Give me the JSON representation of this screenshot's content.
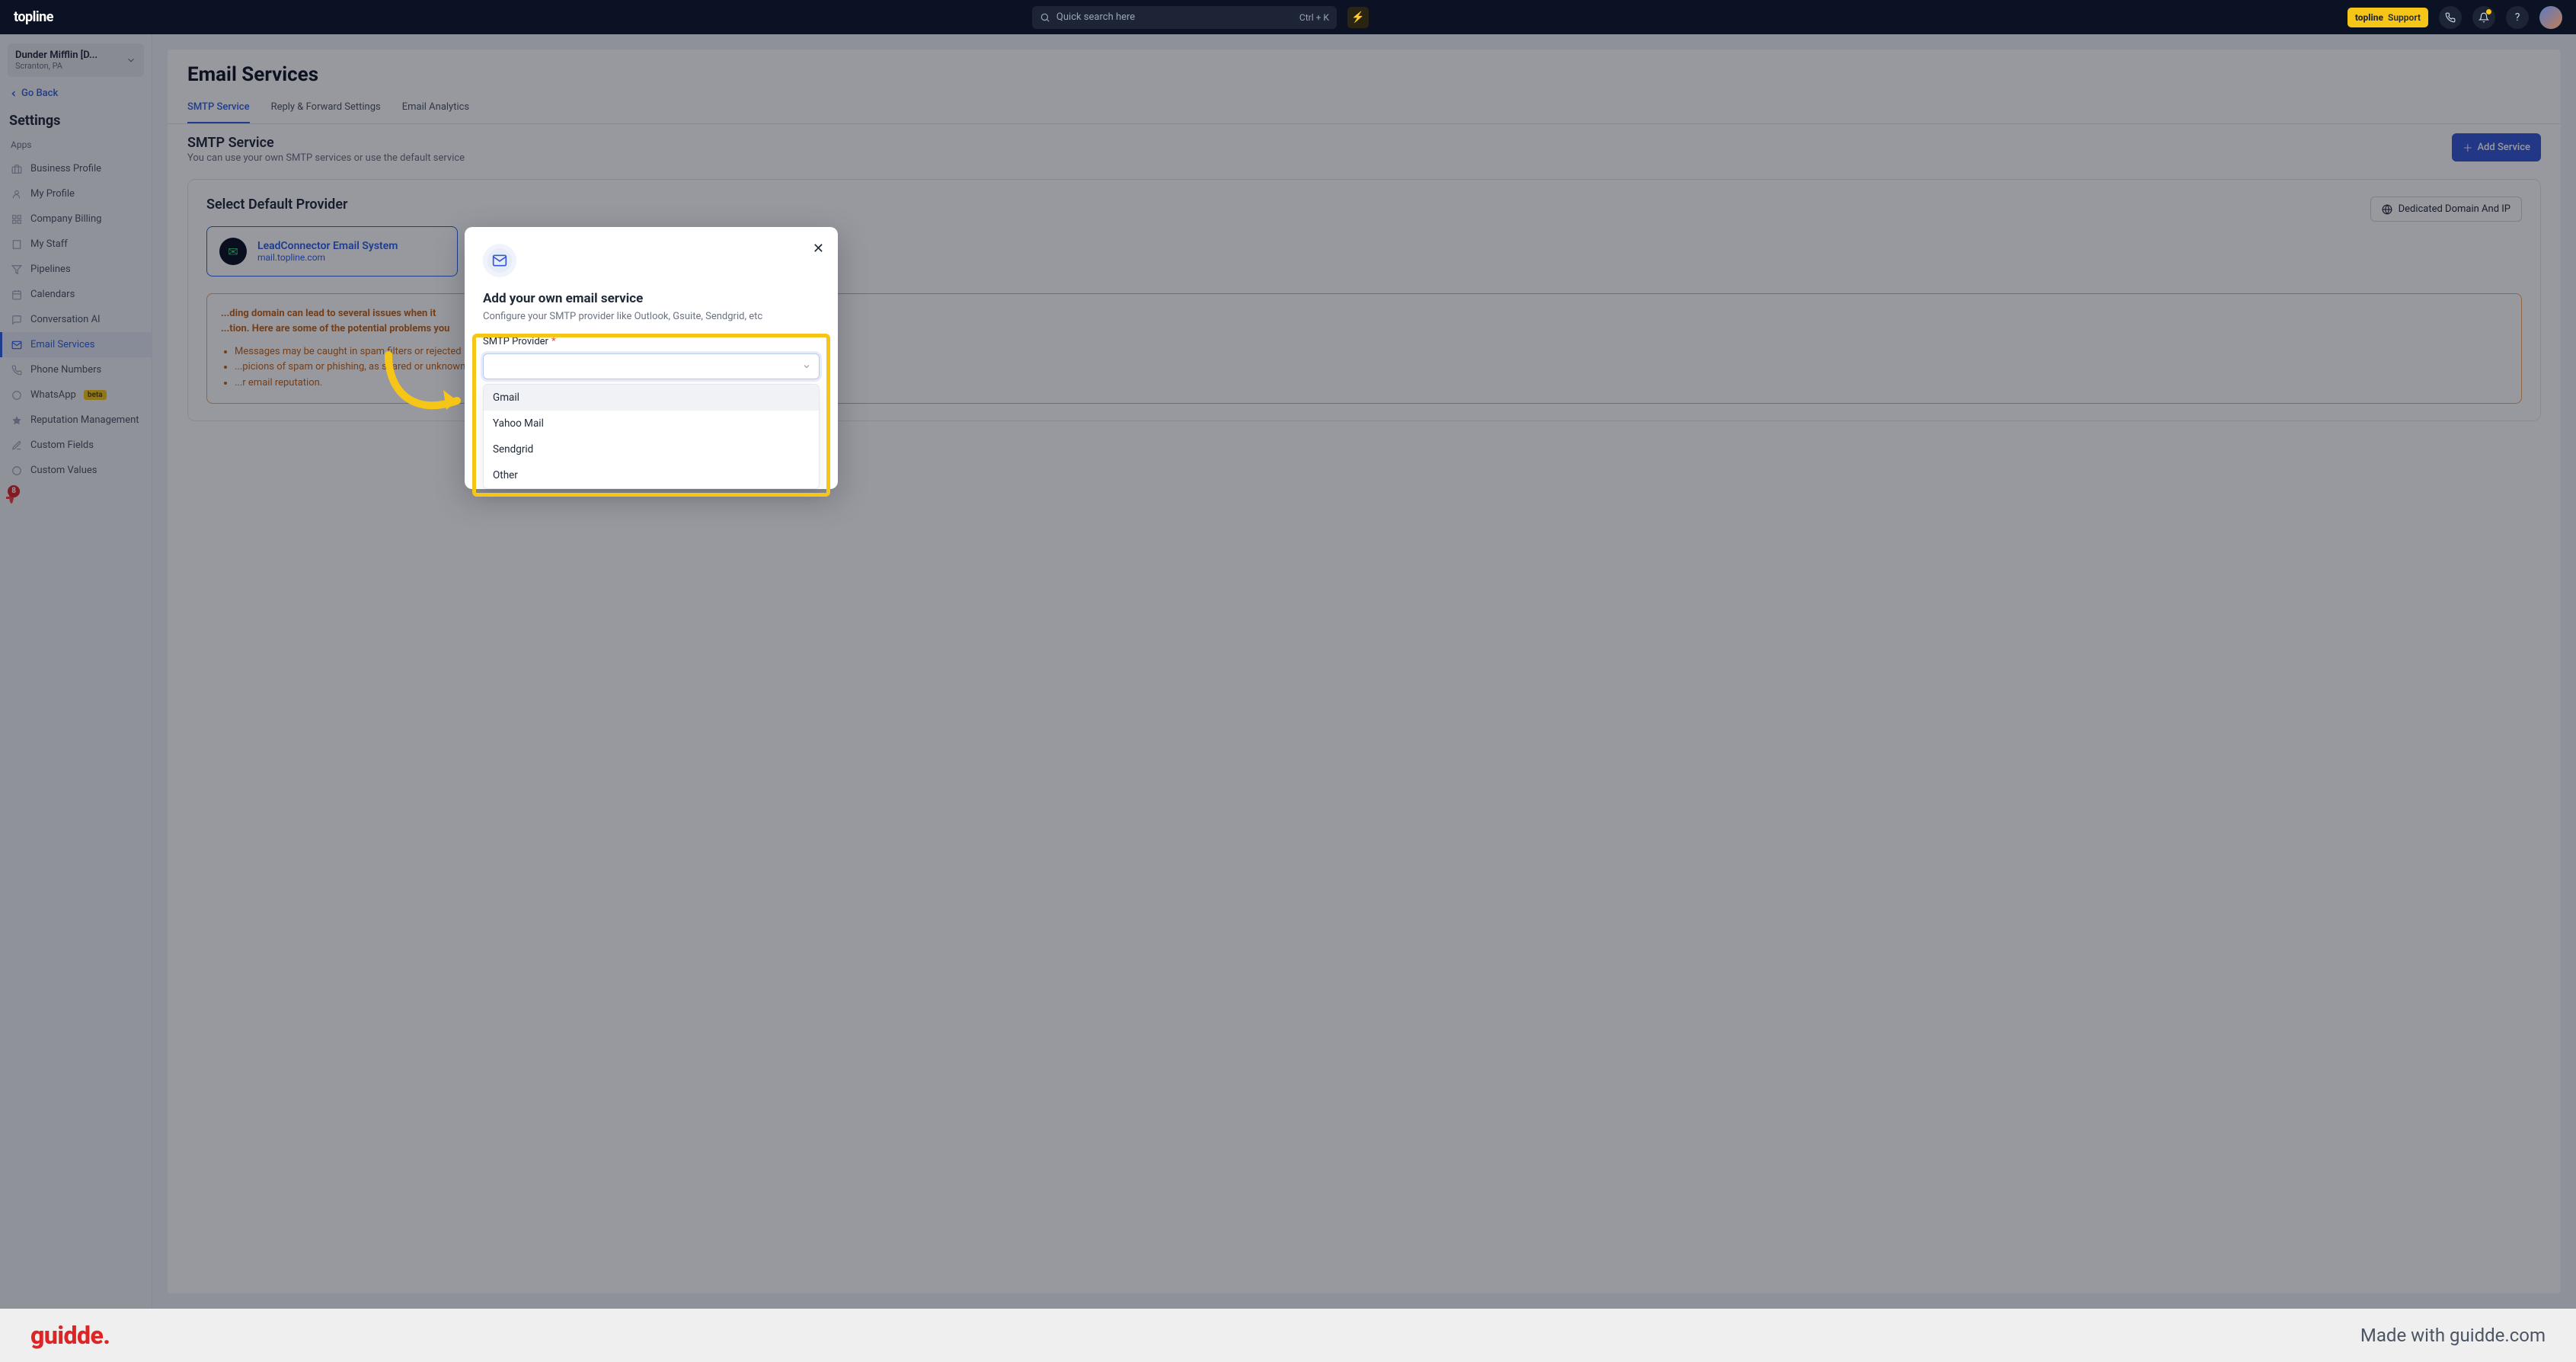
{
  "topnav": {
    "brand": "topline",
    "search_placeholder": "Quick search here",
    "shortcut": "Ctrl + K",
    "support_brand": "topline",
    "support_label": "Support"
  },
  "tenant": {
    "name": "Dunder Mifflin [D...",
    "sub": "Scranton, PA"
  },
  "goback": "Go Back",
  "settings_h": "Settings",
  "section_apps": "Apps",
  "sidebar": {
    "items": [
      {
        "label": "Business Profile",
        "active": false
      },
      {
        "label": "My Profile",
        "active": false
      },
      {
        "label": "Company Billing",
        "active": false
      },
      {
        "label": "My Staff",
        "active": false
      },
      {
        "label": "Pipelines",
        "active": false
      },
      {
        "label": "Calendars",
        "active": false
      },
      {
        "label": "Conversation AI",
        "active": false
      },
      {
        "label": "Email Services",
        "active": true
      },
      {
        "label": "Phone Numbers",
        "active": false
      },
      {
        "label": "WhatsApp",
        "active": false,
        "badge": "beta"
      },
      {
        "label": "Reputation Management",
        "active": false
      },
      {
        "label": "Custom Fields",
        "active": false
      },
      {
        "label": "Custom Values",
        "active": false
      }
    ],
    "gbadge_count": "8"
  },
  "page": {
    "title": "Email Services",
    "tabs": [
      {
        "label": "SMTP Service",
        "active": true
      },
      {
        "label": "Reply & Forward Settings",
        "active": false
      },
      {
        "label": "Email Analytics",
        "active": false
      }
    ],
    "subhead_t": "SMTP Service",
    "subhead_d": "You can use your own SMTP services or use the default service",
    "add_service": "Add Service",
    "panel_title": "Select Default Provider",
    "ddip_btn": "Dedicated Domain And IP",
    "provider_name": "LeadConnector Email System",
    "provider_domain": "mail.topline.com",
    "warn_line1a": "...ding domain can lead to several issues when it",
    "warn_line1b": "...tion. Here are some of the potential problems you",
    "warn_li1": "Messages may be caught in spam filters or rejected",
    "warn_li2": "...picions of spam or phishing, as shared or unknown",
    "warn_li3": "...r email reputation."
  },
  "modal": {
    "title": "Add your own email service",
    "desc": "Configure your SMTP provider like Outlook, Gsuite, Sendgrid, etc",
    "field_label": "SMTP Provider",
    "options": [
      "Gmail",
      "Yahoo Mail",
      "Sendgrid",
      "Other"
    ]
  },
  "footer": {
    "logo": "guidde",
    "made": "Made with guidde.com"
  }
}
